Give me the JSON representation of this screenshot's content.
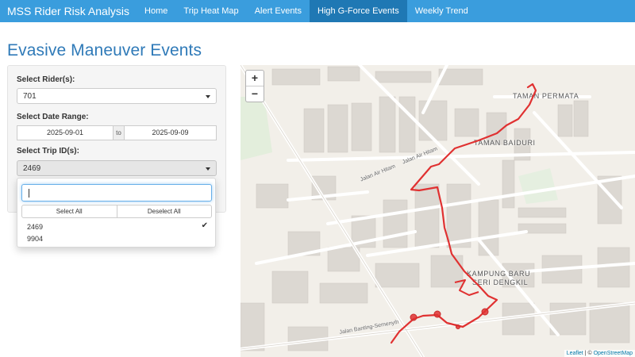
{
  "navbar": {
    "brand": "MSS Rider Risk Analysis",
    "tabs": [
      {
        "label": "Home"
      },
      {
        "label": "Trip Heat Map"
      },
      {
        "label": "Alert Events"
      },
      {
        "label": "High G-Force Events"
      },
      {
        "label": "Weekly Trend"
      }
    ]
  },
  "page_title": "Evasive Maneuver Events",
  "sidebar": {
    "rider_label": "Select Rider(s):",
    "rider_value": "701",
    "date_label": "Select Date Range:",
    "date_start": "2025-09-01",
    "date_sep": "to",
    "date_end": "2025-09-09",
    "trip_label": "Select Trip ID(s):",
    "trip_value": "2469"
  },
  "dropdown": {
    "search_value": "",
    "select_all": "Select All",
    "deselect_all": "Deselect All",
    "options": [
      {
        "label": "2469",
        "selected": true
      },
      {
        "label": "9904",
        "selected": false
      }
    ],
    "check_glyph": "✔"
  },
  "map": {
    "zoom_in": "+",
    "zoom_out": "−",
    "places": {
      "p1": "TAMAN PERMATA",
      "p2": "TAMAN BAIDURI",
      "p3a": "KAMPUNG BARU",
      "p3b": "SERI DENGKIL"
    },
    "roads": {
      "r1": "Jalan Banting-Semenyih",
      "r2": "Jalan Air Hitam",
      "r3": "Jalan Air Hitam"
    },
    "attribution": {
      "leaflet": "Leaflet",
      "sep": " | © ",
      "osm": "OpenStreetMap"
    },
    "route_color": "#e03131"
  }
}
